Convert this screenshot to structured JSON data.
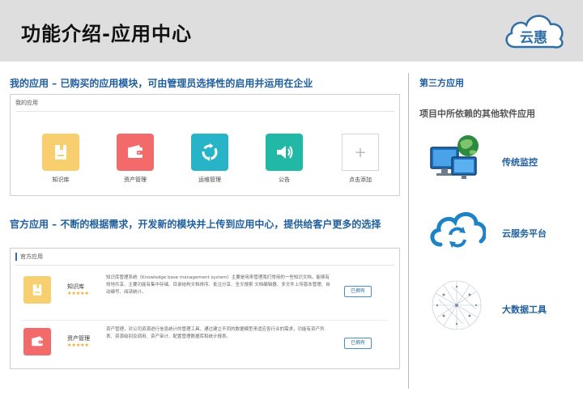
{
  "header": {
    "title": "功能介绍-应用中心",
    "logo_text": "云惠"
  },
  "my_apps": {
    "section_title": "我的应用 – 已购买的应用模块，可由管理员选择性的启用并运用在企业",
    "panel_title": "我的应用",
    "items": [
      {
        "label": "知识库",
        "color": "#f7cf6e",
        "icon": "book-icon"
      },
      {
        "label": "资产管理",
        "color": "#f36a6a",
        "icon": "wallet-icon"
      },
      {
        "label": "运维管理",
        "color": "#27b4c8",
        "icon": "refresh-icon"
      },
      {
        "label": "公告",
        "color": "#21b8a5",
        "icon": "speaker-icon"
      }
    ],
    "add_label": "点击添加"
  },
  "official_apps": {
    "section_title": "官方应用 – 不断的根据需求，开发新的模块并上传到应用中心，提供给客户更多的选择",
    "panel_title": "官方应用",
    "items": [
      {
        "name": "知识库",
        "stars": "★★★★★",
        "desc": "知识库管理系统（Knowledge base management system）主要是用来管理我们常用的一些知识文档，能够有效地共享、主要功能有集中存储、目录结构文档排序、批注分享、全文搜索 文档编辑器、多文件上传版本管理、自动编号、阅读统计。",
        "button": "已拥有",
        "color": "#f7cf6e",
        "icon": "book-icon"
      },
      {
        "name": "资产管理",
        "stars": "★★★★★",
        "desc": "资产管理，对公司资源进行信息统计的管理工具，通过建立不同的数据模型来适应各行业的需求，功能有资产列表、资源级别及调用、资产审计、配置管理数据库和统计报表。",
        "button": "已拥有",
        "color": "#f36a6a",
        "icon": "wallet-icon"
      }
    ]
  },
  "third_party": {
    "title": "第三方应用",
    "subtitle": "项目中所依赖的其他软件应用",
    "items": [
      {
        "label": "传统监控",
        "icon": "monitor-globe-icon"
      },
      {
        "label": "云服务平台",
        "icon": "cloud-sync-icon"
      },
      {
        "label": "大数据工具",
        "icon": "network-graph-icon"
      }
    ]
  }
}
